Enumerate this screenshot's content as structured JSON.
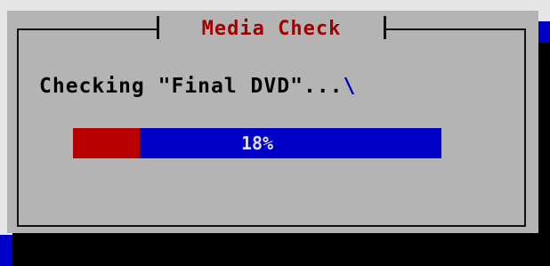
{
  "dialog": {
    "title": "Media Check",
    "message_text": "Checking \"Final DVD\"...",
    "spinner_char": "\\",
    "progress": {
      "percent": 18,
      "label": "18%"
    }
  },
  "colors": {
    "background": "#e6e6e6",
    "dialog_bg": "#b4b4b4",
    "title_color": "#a00000",
    "progress_fill": "#b80000",
    "progress_track": "#0000c8",
    "progress_text": "#e0e0e0"
  },
  "icons": {
    "spinner": "spinner-icon"
  }
}
